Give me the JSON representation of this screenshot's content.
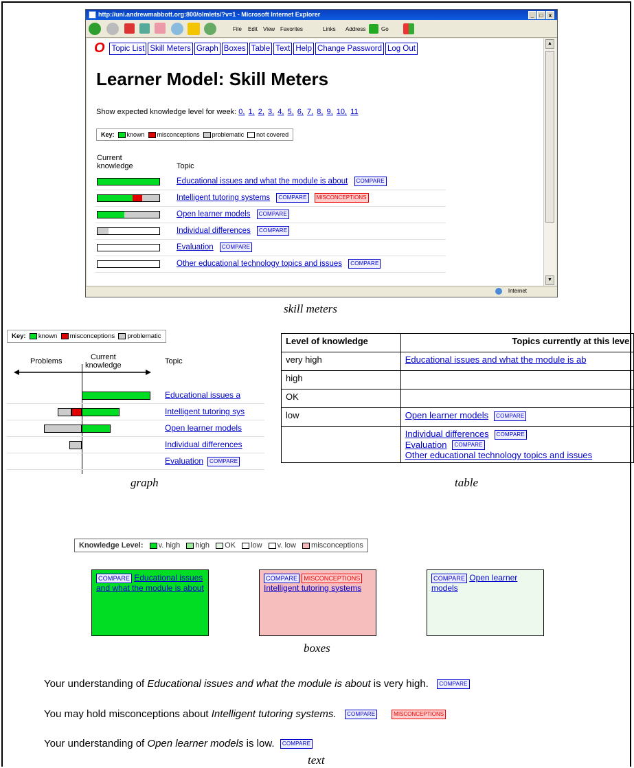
{
  "browser": {
    "title": "http://uni.andrewmabbott.org:800/olmlets/?v=1 - Microsoft Internet Explorer",
    "window_buttons": [
      "_",
      "□",
      "x"
    ],
    "menu": [
      "File",
      "Edit",
      "View",
      "Favorites"
    ],
    "links_label": "Links",
    "address_label": "Address",
    "go_label": "Go",
    "status_zone": "Internet"
  },
  "nav": [
    "Topic List",
    "Skill Meters",
    "Graph",
    "Boxes",
    "Table",
    "Text",
    "Help",
    "Change Password",
    "Log Out"
  ],
  "skill": {
    "heading": "Learner Model: Skill Meters",
    "week_prefix": "Show expected knowledge level for week:",
    "weeks": [
      "0,",
      "1,",
      "2,",
      "3,",
      "4,",
      "5,",
      "6,",
      "7,",
      "8,",
      "9,",
      "10,",
      "11"
    ],
    "key_label": "Key:",
    "key_items": [
      "known",
      "misconceptions",
      "problematic",
      "not covered"
    ],
    "col_current_1": "Current",
    "col_current_2": "knowledge",
    "col_topic": "Topic",
    "compare": "COMPARE",
    "misconceptions_badge": "MISCONCEPTIONS",
    "rows": [
      {
        "topic": "Educational issues and what the module is about",
        "known": 1.0,
        "mis": 0,
        "prob": 0,
        "mis_badge": false
      },
      {
        "topic": "Intelligent tutoring systems",
        "known": 0.55,
        "mis": 0.15,
        "prob": 0.3,
        "mis_badge": true
      },
      {
        "topic": "Open learner models",
        "known": 0.42,
        "mis": 0,
        "prob": 0.58,
        "mis_badge": false
      },
      {
        "topic": "Individual differences",
        "known": 0,
        "mis": 0,
        "prob": 0.17,
        "mis_badge": false
      },
      {
        "topic": "Evaluation",
        "known": 0,
        "mis": 0,
        "prob": 0,
        "mis_badge": false
      },
      {
        "topic": "Other educational technology topics and issues",
        "known": 0,
        "mis": 0,
        "prob": 0,
        "mis_badge": false
      }
    ],
    "caption": "skill meters"
  },
  "graph": {
    "key_label": "Key:",
    "key_items": [
      "known",
      "misconceptions",
      "problematic"
    ],
    "col_problems": "Problems",
    "col_current_1": "Current",
    "col_current_2": "knowledge",
    "col_topic": "Topic",
    "rows": [
      {
        "topic": "Educational issues a",
        "known": 1.0,
        "mis": 0,
        "prob": 0
      },
      {
        "topic": "Intelligent tutoring sys",
        "known": 0.55,
        "mis": 0.15,
        "prob": 0.2
      },
      {
        "topic": "Open learner models",
        "known": 0.42,
        "mis": 0,
        "prob": 0.55
      },
      {
        "topic": "Individual differences",
        "known": 0,
        "mis": 0,
        "prob": 0.18
      },
      {
        "topic": "Evaluation",
        "known": 0,
        "mis": 0,
        "prob": 0,
        "compare": true
      }
    ],
    "compare": "COMPARE",
    "caption": "graph"
  },
  "table": {
    "col1": "Level of knowledge",
    "col2": "Topics currently at this level",
    "rows": [
      {
        "level": "very high",
        "topics": [
          "Educational issues and what the module is ab"
        ]
      },
      {
        "level": "high",
        "topics": []
      },
      {
        "level": "OK",
        "topics": []
      },
      {
        "level": "low",
        "topics": [
          "Open learner models"
        ]
      },
      {
        "level": "",
        "topics": [
          "Individual differences",
          "Evaluation",
          "Other educational technology topics and issues"
        ]
      }
    ],
    "compare": "COMPARE",
    "caption": "table"
  },
  "boxes": {
    "key_label": "Knowledge Level:",
    "key_items": [
      {
        "label": "v. high",
        "color": "#00dd22"
      },
      {
        "label": "high",
        "color": "#99ee99"
      },
      {
        "label": "OK",
        "color": "#e6f7e6"
      },
      {
        "label": "low",
        "color": "#ffffff"
      },
      {
        "label": "v. low",
        "color": "#ffffff"
      },
      {
        "label": "misconceptions",
        "color": "#f5b7b7"
      }
    ],
    "items": [
      {
        "topic": "Educational issues and what the module is about",
        "color": "#00dd22",
        "mis": false
      },
      {
        "topic": "Intelligent tutoring systems",
        "color": "#f7bebe",
        "mis": true
      },
      {
        "topic": "Open learner models",
        "color": "#eef9ee",
        "mis": false
      }
    ],
    "compare": "COMPARE",
    "misconceptions": "MISCONCEPTIONS",
    "caption": "boxes"
  },
  "text": {
    "line1_pre": "Your understanding of ",
    "line1_topic": "Educational issues and what the module is about",
    "line1_post": " is very high.",
    "line2_pre": "You may hold misconceptions about ",
    "line2_topic": "Intelligent tutoring systems.",
    "line3_pre": "Your understanding of ",
    "line3_topic": "Open learner models",
    "line3_post": " is low.",
    "compare": "COMPARE",
    "misconceptions": "MISCONCEPTIONS",
    "caption": "text"
  },
  "colors": {
    "known": "#00dd22",
    "misconceptions": "#e00000",
    "problematic": "#cccccc",
    "link": "#0000cc"
  }
}
